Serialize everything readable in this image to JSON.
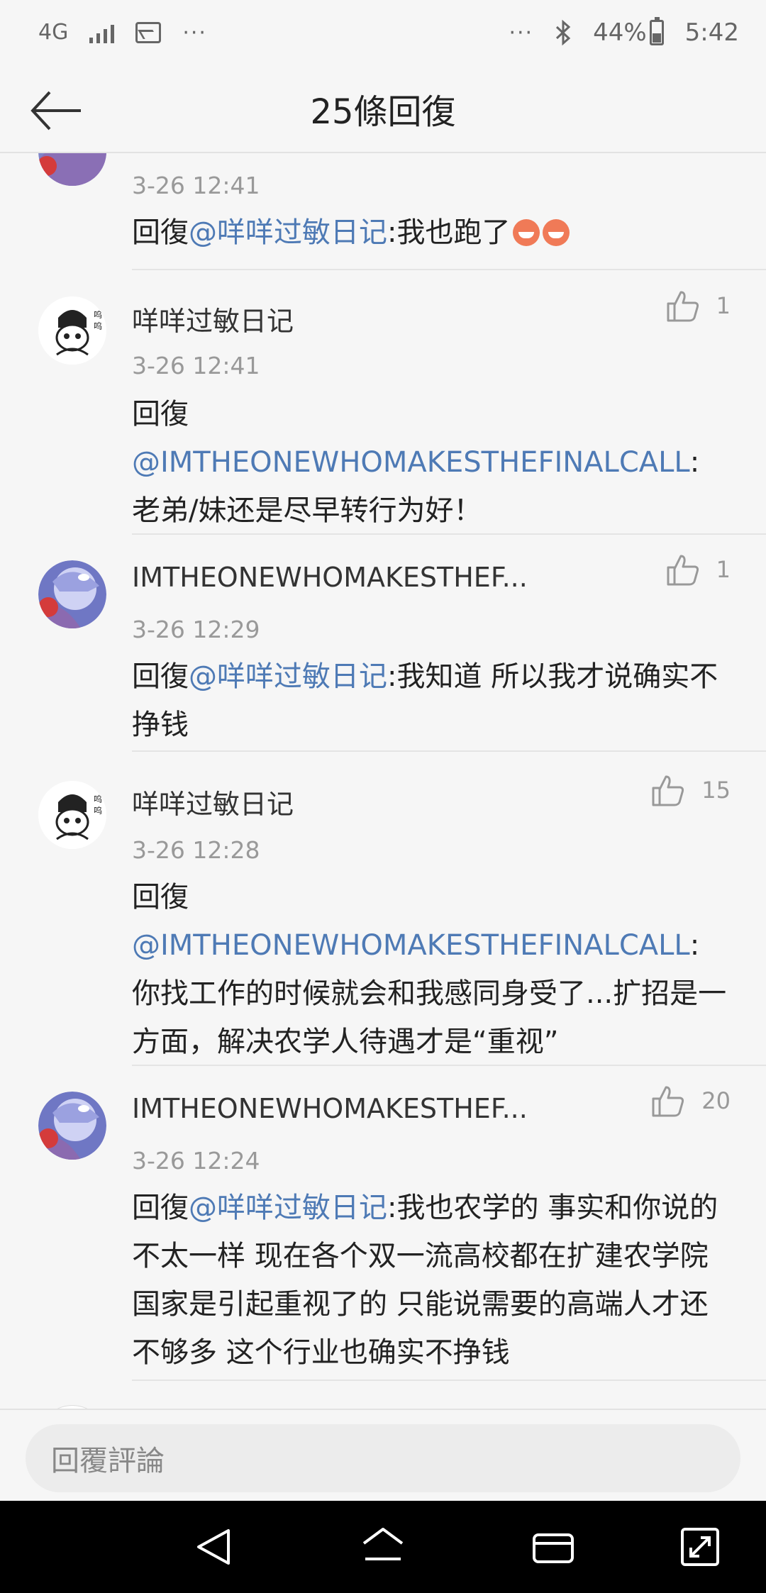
{
  "status_bar": {
    "network": "4G",
    "overflow_left": "···",
    "overflow_right": "···",
    "bluetooth_icon": "bluetooth-icon",
    "battery": "44%",
    "battery_level": 0.44,
    "time": "5:42"
  },
  "header": {
    "title": "25條回復",
    "back_icon": "back-arrow-icon"
  },
  "comments": [
    {
      "username": "",
      "time": "3-26 12:41",
      "reply_prefix": "回復",
      "mention": "@咩咩过敏日记",
      "text": ":我也跑了",
      "emojis": [
        "laughing-emoji",
        "laughing-emoji"
      ]
    },
    {
      "username": "咩咩过敏日记",
      "time": "3-26 12:41",
      "likes": "1",
      "reply_prefix": "回復",
      "mention": "@IMTHEONEWHOMAKESTHEFINALCALL",
      "text": ":老弟/妹还是尽早转行为好！"
    },
    {
      "username": "IMTHEONEWHOMAKESTHEF...",
      "time": "3-26 12:29",
      "likes": "1",
      "reply_prefix": "回復",
      "mention": "@咩咩过敏日记",
      "text": ":我知道 所以我才说确实不挣钱"
    },
    {
      "username": "咩咩过敏日记",
      "time": "3-26 12:28",
      "likes": "15",
      "reply_prefix": "回復",
      "mention": "@IMTHEONEWHOMAKESTHEFINALCALL",
      "text": ":你找工作的时候就会和我感同身受了...扩招是一方面，解决农学人待遇才是“重视”"
    },
    {
      "username": "IMTHEONEWHOMAKESTHEF...",
      "time": "3-26 12:24",
      "likes": "20",
      "reply_prefix": "回復",
      "mention": "@咩咩过敏日记",
      "text": ":我也农学的 事实和你说的不太一样 现在各个双一流高校都在扩建农学院 国家是引起重视了的 只能说需要的高端人才还不够多 这个行业也确实不挣钱"
    }
  ],
  "reply_bar": {
    "placeholder": "回覆評論"
  },
  "nav_bar": {
    "back": "nav-back-icon",
    "home": "nav-home-icon",
    "recents": "nav-recents-icon",
    "expand": "nav-expand-icon"
  }
}
